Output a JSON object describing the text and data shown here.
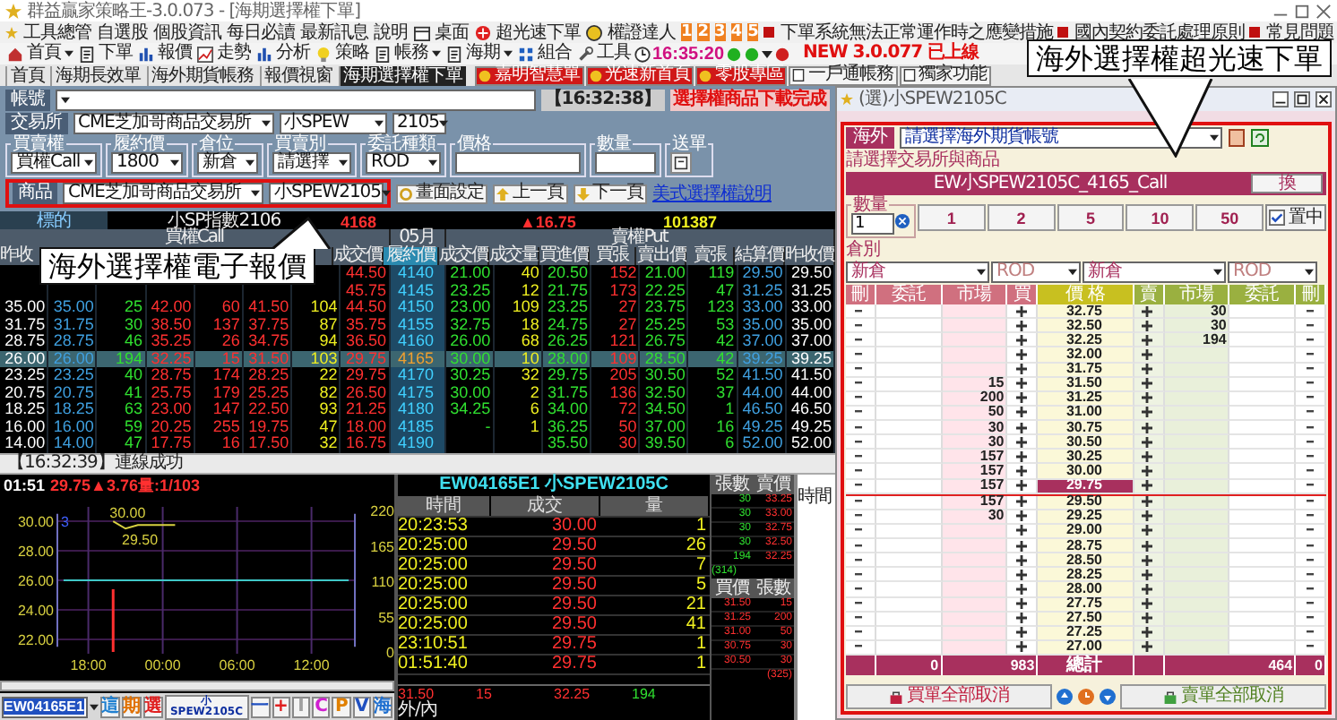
{
  "window": {
    "title": "群益贏家策略王-3.0.073 - [海期選擇權下單]"
  },
  "menu": {
    "items": [
      "工具總管",
      "自選股",
      "個股資訊",
      "每日必讀",
      "最新訊息",
      "說明"
    ],
    "shortcuts": [
      "桌面",
      "超光速下單",
      "權證達人"
    ],
    "numbers": [
      "1",
      "2",
      "3",
      "4",
      "5"
    ],
    "notices": [
      "下單系統無法正常運作時之應變措施",
      "國內契約委託處理原則",
      "常見問題"
    ]
  },
  "toolbar": {
    "items": [
      {
        "label": "首頁",
        "dropdown": true
      },
      {
        "label": "下單",
        "dropdown": false
      },
      {
        "label": "報價",
        "dropdown": false
      },
      {
        "label": "走勢",
        "dropdown": false
      },
      {
        "label": "分析",
        "dropdown": false
      },
      {
        "label": "策略",
        "dropdown": false
      },
      {
        "label": "帳務",
        "dropdown": true
      },
      {
        "label": "海期",
        "dropdown": true
      },
      {
        "label": "組合",
        "dropdown": false
      },
      {
        "label": "工具",
        "dropdown": false
      }
    ],
    "clock": "16:35:20",
    "new_version": "NEW 3.0.077 已上線"
  },
  "tabs": [
    {
      "label": "首頁",
      "selected": false
    },
    {
      "label": "海期長效單",
      "selected": false
    },
    {
      "label": "海外期貨帳務",
      "selected": false
    },
    {
      "label": "報價視窗",
      "selected": false
    },
    {
      "label": "海期選擇權下單",
      "selected": true
    }
  ],
  "quick_buttons": [
    {
      "label": "嘉明智慧單",
      "kind": "highlight"
    },
    {
      "label": "光速新首頁",
      "kind": "highlight"
    },
    {
      "label": "零股專區",
      "kind": "highlight"
    },
    {
      "label": "一戶通帳務",
      "kind": "plain"
    },
    {
      "label": "獨家功能",
      "kind": "plain"
    }
  ],
  "order_form": {
    "account_label": "帳號",
    "time_tag": "【16:32:38】",
    "message": "選擇權商品下載完成",
    "exchange_label": "交易所",
    "exchange": "CME芝加哥商品交易所",
    "product": "小SPEW",
    "month": "2105",
    "fields": [
      {
        "label": "買賣權",
        "value": "買權Call",
        "kind": "select"
      },
      {
        "label": "履約價",
        "value": "1800",
        "kind": "select"
      },
      {
        "label": "倉位",
        "value": "新倉",
        "kind": "select"
      },
      {
        "label": "買賣別",
        "value": "請選擇",
        "kind": "select"
      },
      {
        "label": "委託種類",
        "value": "ROD",
        "kind": "select"
      },
      {
        "label": "價格",
        "kind": "input"
      },
      {
        "label": "數量",
        "kind": "input"
      },
      {
        "label": "送單",
        "kind": "button"
      }
    ]
  },
  "product_row": {
    "label": "商品",
    "exchange": "CME芝加哥商品交易所",
    "product": "小SPEW2105",
    "buttons": [
      "畫面設定",
      "上一頁",
      "下一頁"
    ],
    "link": "美式選擇權說明"
  },
  "underlying": {
    "label": "標的",
    "name": "小SP指數2106",
    "price": "4168",
    "change": "▲16.75",
    "volume": "101387"
  },
  "quote_table": {
    "call_title": "買權Call",
    "month": "05月",
    "put_title": "賣權Put",
    "call_columns": [
      "昨收",
      "成交價"
    ],
    "strike_column": "履約價",
    "put_columns": [
      "成交價",
      "成交量",
      "買進價",
      "買張",
      "賣出價",
      "賣張",
      "結算價",
      "昨收價"
    ],
    "rows": [
      {
        "strike": "4140",
        "selected": false,
        "call": [
          "44.50"
        ],
        "put": [
          "21.00",
          "40",
          "20.50",
          "152",
          "21.00",
          "119",
          "29.50",
          "29.50"
        ]
      },
      {
        "strike": "4145",
        "selected": false,
        "call": [
          "45.75"
        ],
        "put": [
          "23.25",
          "12",
          "21.75",
          "173",
          "22.25",
          "47",
          "31.25",
          "31.25"
        ]
      },
      {
        "strike": "4150",
        "selected": false,
        "call": [
          "35.00",
          "35.00",
          "25",
          "42.00",
          "60",
          "41.50",
          "104",
          "44.50"
        ],
        "put": [
          "23.00",
          "109",
          "23.25",
          "27",
          "23.75",
          "123",
          "33.00",
          "33.00"
        ]
      },
      {
        "strike": "4155",
        "selected": false,
        "call": [
          "31.75",
          "31.75",
          "30",
          "38.50",
          "137",
          "37.75",
          "87",
          "35.75"
        ],
        "put": [
          "32.75",
          "18",
          "24.75",
          "27",
          "25.25",
          "53",
          "35.00",
          "35.00"
        ]
      },
      {
        "strike": "4160",
        "selected": false,
        "call": [
          "28.75",
          "28.75",
          "46",
          "35.25",
          "26",
          "34.75",
          "94",
          "36.50"
        ],
        "put": [
          "26.00",
          "68",
          "26.25",
          "121",
          "26.75",
          "42",
          "37.00",
          "37.00"
        ]
      },
      {
        "strike": "4165",
        "selected": true,
        "call": [
          "26.00",
          "26.00",
          "194",
          "32.25",
          "15",
          "31.50",
          "103",
          "29.75"
        ],
        "put": [
          "30.00",
          "10",
          "28.00",
          "109",
          "28.50",
          "42",
          "39.25",
          "39.25"
        ]
      },
      {
        "strike": "4170",
        "selected": false,
        "call": [
          "23.25",
          "23.25",
          "40",
          "28.75",
          "174",
          "28.25",
          "22",
          "29.75"
        ],
        "put": [
          "30.25",
          "32",
          "29.75",
          "205",
          "30.50",
          "52",
          "41.50",
          "41.50"
        ]
      },
      {
        "strike": "4175",
        "selected": false,
        "call": [
          "20.75",
          "20.75",
          "41",
          "25.75",
          "179",
          "25.25",
          "82",
          "26.50"
        ],
        "put": [
          "30.00",
          "2",
          "31.75",
          "136",
          "32.50",
          "37",
          "44.00",
          "44.00"
        ]
      },
      {
        "strike": "4180",
        "selected": false,
        "call": [
          "18.25",
          "18.25",
          "63",
          "23.00",
          "147",
          "22.50",
          "93",
          "21.25"
        ],
        "put": [
          "34.25",
          "6",
          "34.00",
          "72",
          "34.50",
          "1",
          "46.50",
          "46.50"
        ]
      },
      {
        "strike": "4185",
        "selected": false,
        "call": [
          "16.00",
          "16.00",
          "59",
          "20.25",
          "255",
          "19.75",
          "47",
          "18.00"
        ],
        "put": [
          "-",
          "1",
          "36.25",
          "50",
          "37.00",
          "16",
          "49.25",
          "49.25"
        ]
      },
      {
        "strike": "4190",
        "selected": false,
        "call": [
          "14.00",
          "14.00",
          "47",
          "17.75",
          "16",
          "17.50",
          "32",
          "16.75"
        ],
        "put": [
          "35.50",
          "30",
          "39.50",
          "6",
          "52.00",
          "52.00"
        ]
      }
    ]
  },
  "status": "【16:32:39】連線成功",
  "chart_panel": {
    "time": "01:51",
    "quote": "29.75▲3.76量:1/103",
    "volume_ticks": [
      "220",
      "165",
      "110",
      "55",
      "0"
    ],
    "marker": "3",
    "chart_data": {
      "type": "line",
      "categories": [
        null,
        null,
        "18:00",
        null,
        null,
        null,
        null,
        null,
        "00:00",
        null,
        null,
        null,
        null,
        null,
        "06:00",
        null,
        null,
        null,
        null,
        null,
        "12:00",
        null,
        null,
        null
      ],
      "series": [
        {
          "color": "#d8d040",
          "values": [
            null,
            null,
            null,
            null,
            30.0,
            29.5,
            29.75,
            29.75,
            29.75,
            29.75,
            null,
            null,
            null,
            null,
            null,
            null,
            null,
            null,
            null,
            null,
            null,
            null,
            null,
            null
          ]
        },
        {
          "color": "#40c8c8",
          "values": [
            26,
            26,
            26,
            26,
            26,
            26,
            26,
            26,
            26,
            26,
            26,
            26,
            26,
            26,
            26,
            26,
            26,
            26,
            26,
            26,
            26,
            26,
            26,
            26
          ]
        }
      ],
      "grid": true,
      "ylim": [
        21.5,
        30.5
      ],
      "yticks": [
        {
          "value": 30,
          "label": "30.00"
        },
        {
          "value": 28,
          "label": "28.00"
        },
        {
          "value": 26,
          "label": "26.00"
        },
        {
          "value": 24,
          "label": "24.00"
        },
        {
          "value": 22,
          "label": "22.00"
        }
      ],
      "annotations": [
        "30.00",
        "29.50"
      ]
    },
    "symbol": "EW04165E1",
    "mode_buttons": [
      "這",
      "期",
      "選"
    ],
    "product_button": [
      "小",
      "SPEW2105C"
    ],
    "tool_buttons": [
      {
        "label": "一",
        "color": "#2050c0"
      },
      {
        "label": "+",
        "color": "#e02020"
      },
      {
        "label": "I",
        "color": "#a0a0a0"
      },
      {
        "label": "C",
        "color": "#d020d0"
      },
      {
        "label": "P",
        "color": "#e08000"
      },
      {
        "label": "V",
        "color": "#2050c0"
      },
      {
        "label": "海",
        "color": "#2070d0"
      }
    ]
  },
  "trades": {
    "title": "EW04165E1 小SPEW2105C",
    "columns": [
      "時間",
      "成交",
      "量"
    ],
    "rows": [
      {
        "time": "20:23:53",
        "price": "30.00",
        "qty": "1"
      },
      {
        "time": "20:25:00",
        "price": "29.50",
        "qty": "26"
      },
      {
        "time": "20:25:00",
        "price": "29.50",
        "qty": "7"
      },
      {
        "time": "20:25:00",
        "price": "29.50",
        "qty": "5"
      },
      {
        "time": "20:25:00",
        "price": "29.50",
        "qty": "21"
      },
      {
        "time": "20:25:00",
        "price": "29.50",
        "qty": "41"
      },
      {
        "time": "23:10:51",
        "price": "29.75",
        "qty": "1"
      },
      {
        "time": "01:51:40",
        "price": "29.75",
        "qty": "1"
      }
    ],
    "footer": [
      "31.50",
      "15",
      "32.25",
      "194"
    ],
    "footer_label": "外/內"
  },
  "mini_book": {
    "ask_columns": [
      "張數",
      "賣價"
    ],
    "asks": [
      [
        "30",
        "33.25"
      ],
      [
        "30",
        "33.00"
      ],
      [
        "30",
        "32.75"
      ],
      [
        "30",
        "32.50"
      ],
      [
        "194",
        "32.25"
      ]
    ],
    "ask_total": "(314)",
    "bid_columns": [
      "買價",
      "張數"
    ],
    "bids": [
      [
        "31.50",
        "15"
      ],
      [
        "31.25",
        "200"
      ],
      [
        "31.00",
        "50"
      ],
      [
        "30.75",
        "30"
      ],
      [
        "30.50",
        "30"
      ]
    ],
    "bid_total": "(325)"
  },
  "time_column": "時間",
  "order_window": {
    "title": "(選)小SPEW2105C",
    "account_tag": "海外",
    "account": "請選擇海外期貨帳號",
    "section_label": "請選擇交易所與商品",
    "contract": "EW小SPEW2105C_4165_Call",
    "switch_button": "換",
    "qty_label": "數量",
    "qty": "1",
    "quick_qty": [
      "1",
      "2",
      "5",
      "10",
      "50"
    ],
    "center": {
      "label": "置中",
      "checked": true
    },
    "position_label": "倉別",
    "selects": [
      "新倉",
      "ROD",
      "新倉",
      "ROD"
    ],
    "ladder_columns": [
      "刪",
      "委託",
      "市場",
      "買",
      "價 格",
      "賣",
      "市場",
      "委託",
      "刪"
    ],
    "ladder": [
      {
        "price": "32.75",
        "sell_market": "30",
        "selected": false
      },
      {
        "price": "32.50",
        "sell_market": "30",
        "selected": false
      },
      {
        "price": "32.25",
        "sell_market": "194",
        "selected": false
      },
      {
        "price": "32.00",
        "selected": false
      },
      {
        "price": "31.75",
        "selected": false
      },
      {
        "price": "31.50",
        "buy_market": "15",
        "selected": false
      },
      {
        "price": "31.25",
        "buy_market": "200",
        "selected": false
      },
      {
        "price": "31.00",
        "buy_market": "50",
        "selected": false
      },
      {
        "price": "30.75",
        "buy_market": "30",
        "selected": false
      },
      {
        "price": "30.50",
        "buy_market": "30",
        "selected": false
      },
      {
        "price": "30.25",
        "buy_market": "157",
        "selected": false
      },
      {
        "price": "30.00",
        "buy_market": "157",
        "selected": false
      },
      {
        "price": "29.75",
        "buy_market": "157",
        "selected": true
      },
      {
        "price": "29.50",
        "buy_market": "157",
        "selected": false
      },
      {
        "price": "29.25",
        "buy_market": "30",
        "selected": false
      },
      {
        "price": "29.00",
        "selected": false
      },
      {
        "price": "28.75",
        "selected": false
      },
      {
        "price": "28.50",
        "selected": false
      },
      {
        "price": "28.25",
        "selected": false
      },
      {
        "price": "28.00",
        "selected": false
      },
      {
        "price": "27.75",
        "selected": false
      },
      {
        "price": "27.50",
        "selected": false
      },
      {
        "price": "27.25",
        "selected": false
      },
      {
        "price": "27.00",
        "selected": false
      }
    ],
    "totals": [
      "0",
      "983",
      "總計",
      "464",
      "0"
    ],
    "cancel_buy": "買單全部取消",
    "cancel_sell": "賣單全部取消"
  },
  "callouts": [
    {
      "text": "海外選擇權超光速下單"
    },
    {
      "text": "海外選擇權電子報價"
    }
  ]
}
